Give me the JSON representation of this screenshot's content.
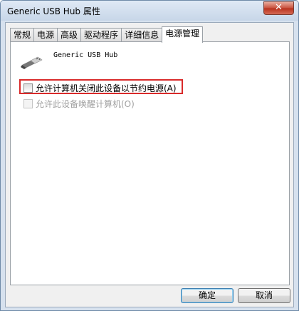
{
  "window": {
    "title": "Generic USB Hub 属性",
    "close_glyph": "✕"
  },
  "tabs": [
    {
      "label": "常规"
    },
    {
      "label": "电源"
    },
    {
      "label": "高级"
    },
    {
      "label": "驱动程序"
    },
    {
      "label": "详细信息"
    },
    {
      "label": "电源管理",
      "active": true
    }
  ],
  "device": {
    "name": "Generic USB Hub",
    "icon": "usb-plug-icon"
  },
  "options": {
    "allow_turn_off": {
      "label": "允许计算机关闭此设备以节约电源(A)",
      "checked": false
    },
    "allow_wake": {
      "label": "允许此设备唤醒计算机(O)",
      "checked": false,
      "disabled": true
    }
  },
  "buttons": {
    "ok": "确定",
    "cancel": "取消"
  },
  "colors": {
    "highlight": "#d92a2a"
  }
}
